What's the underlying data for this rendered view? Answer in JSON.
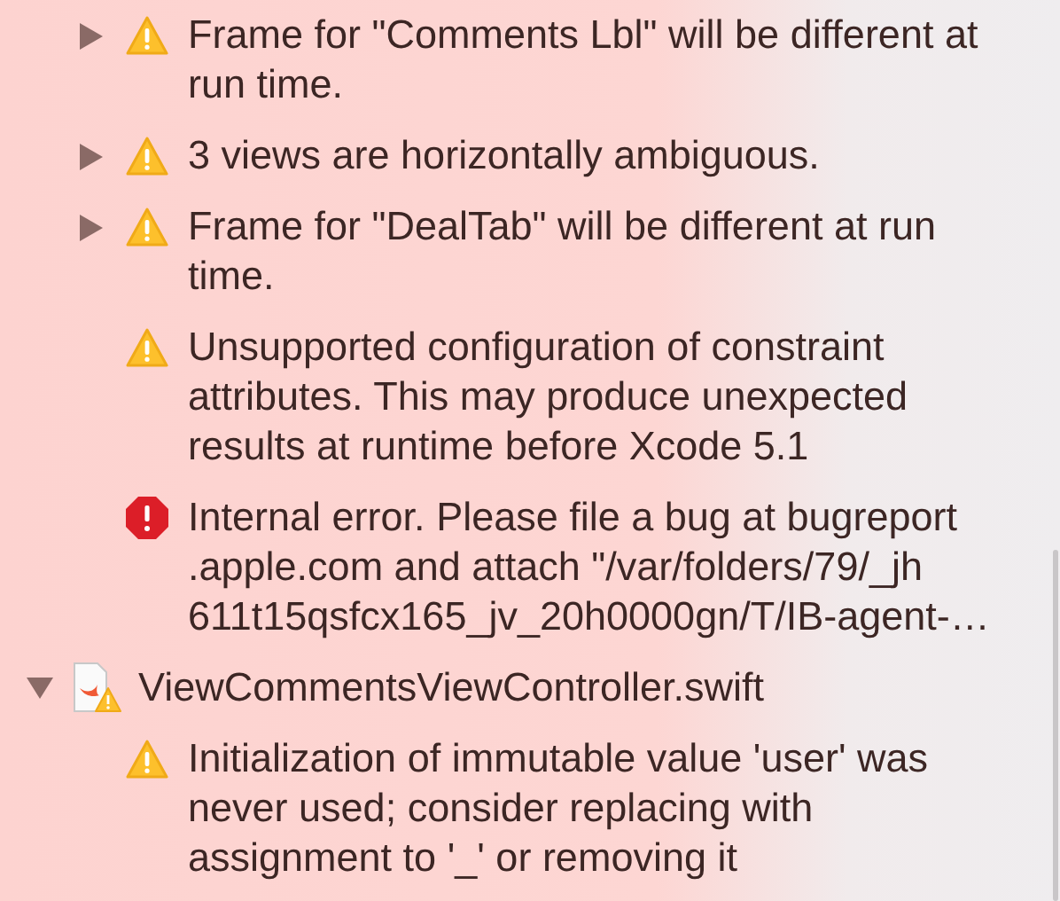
{
  "issues": [
    {
      "kind": "warning",
      "expandable": true,
      "expanded": false,
      "lines": [
        "Frame for \"Comments Lbl\" will be different at",
        "run time."
      ]
    },
    {
      "kind": "warning",
      "expandable": true,
      "expanded": false,
      "lines": [
        "3 views are horizontally ambiguous."
      ]
    },
    {
      "kind": "warning",
      "expandable": true,
      "expanded": false,
      "lines": [
        "Frame for \"DealTab\" will be different at run",
        "time."
      ]
    },
    {
      "kind": "warning",
      "expandable": false,
      "lines": [
        "Unsupported configuration of constraint",
        "attributes. This may produce unexpected",
        "results at runtime before Xcode 5.1"
      ]
    },
    {
      "kind": "error",
      "expandable": false,
      "lines": [
        "Internal error. Please file a bug at bugreport",
        ".apple.com and attach \"/var/folders/79/_jh",
        "611t15qsfcx165_jv_20h0000gn/T/IB-agent-…"
      ]
    }
  ],
  "file": {
    "name": "ViewCommentsViewController.swift",
    "expanded": true,
    "children": [
      {
        "kind": "warning",
        "expandable": false,
        "lines": [
          "Initialization of immutable value 'user' was",
          "never used; consider replacing with",
          "assignment to '_' or removing it"
        ]
      }
    ]
  }
}
